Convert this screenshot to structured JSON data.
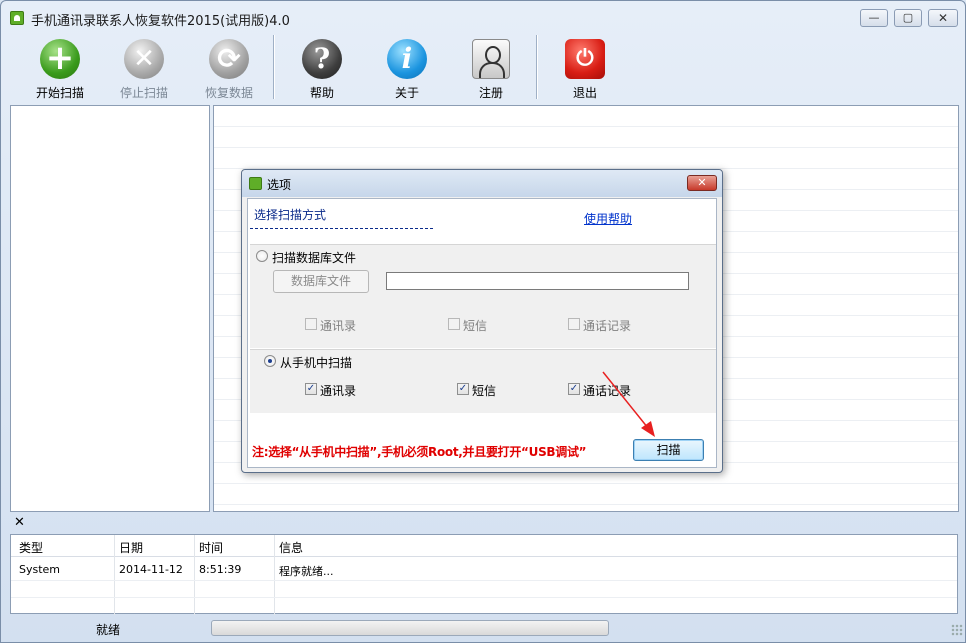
{
  "window": {
    "title": "手机通讯录联系人恢复软件2015(试用版)4.0",
    "controls": {
      "minimize": "—",
      "maximize": "▢",
      "close": "✕"
    }
  },
  "toolbar": {
    "buttons": [
      {
        "label": "开始扫描",
        "icon": "add-icon",
        "glyph": "+",
        "enabled": true
      },
      {
        "label": "停止扫描",
        "icon": "stop-icon",
        "glyph": "✕",
        "enabled": false
      },
      {
        "label": "恢复数据",
        "icon": "refresh-icon",
        "glyph": "⟳",
        "enabled": false
      },
      {
        "label": "帮助",
        "icon": "help-icon",
        "glyph": "?",
        "enabled": true
      },
      {
        "label": "关于",
        "icon": "info-icon",
        "glyph": "i",
        "enabled": true
      },
      {
        "label": "注册",
        "icon": "user-icon",
        "glyph": "",
        "enabled": true
      },
      {
        "label": "退出",
        "icon": "power-icon",
        "glyph": "⏻",
        "enabled": true
      }
    ]
  },
  "log": {
    "close_glyph": "✕",
    "columns": [
      "类型",
      "日期",
      "时间",
      "信息"
    ],
    "rows": [
      {
        "type": "System",
        "date": "2014-11-12",
        "time": "8:51:39",
        "info": "程序就绪..."
      }
    ]
  },
  "statusbar": {
    "text": "就绪"
  },
  "dialog": {
    "title": "选项",
    "close_glyph": "✕",
    "header_label": "选择扫描方式",
    "help_link": "使用帮助",
    "option_db": {
      "label": "扫描数据库文件",
      "selected": false,
      "db_button": "数据库文件",
      "path_value": "",
      "checks": [
        {
          "label": "通讯录",
          "checked": false
        },
        {
          "label": "短信",
          "checked": false
        },
        {
          "label": "通话记录",
          "checked": false
        }
      ]
    },
    "option_phone": {
      "label": "从手机中扫描",
      "selected": true,
      "checks": [
        {
          "label": "通讯录",
          "checked": true
        },
        {
          "label": "短信",
          "checked": true
        },
        {
          "label": "通话记录",
          "checked": true
        }
      ]
    },
    "note": "注:选择“从手机中扫描”,手机必须Root,并且要打开“USB调试”",
    "scan_button": "扫描",
    "accent_color": "#e00000"
  }
}
